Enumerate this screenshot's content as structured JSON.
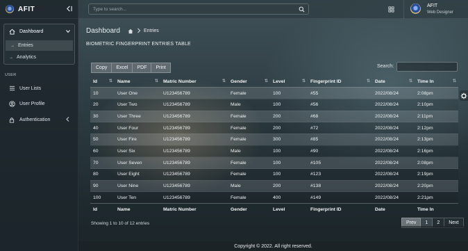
{
  "brand": {
    "name": "AFIT"
  },
  "sidebar": {
    "dashboard_label": "Dashboard",
    "sub_items": [
      {
        "label": "Entries"
      },
      {
        "label": "Analytics"
      }
    ],
    "section_label": "USER",
    "items": [
      {
        "label": "User Lists"
      },
      {
        "label": "User Profile"
      },
      {
        "label": "Authentication"
      }
    ]
  },
  "topbar": {
    "search_placeholder": "Type to search...",
    "user_name": "AFIT",
    "user_role": "Web Designer"
  },
  "breadcrumb": {
    "title": "Dashboard",
    "current": "Entries"
  },
  "table_title": "BIOMETRIC FINGERPRINT ENTRIES TABLE",
  "export_buttons": [
    "Copy",
    "Excel",
    "PDF",
    "Print"
  ],
  "table_search_label": "Search:",
  "table": {
    "columns": [
      "Id",
      "Name",
      "Matric Number",
      "Gender",
      "Level",
      "Fingerprint ID",
      "Date",
      "Time In"
    ],
    "rows": [
      [
        "10",
        "User One",
        "U123456789",
        "Female",
        "100",
        "#55",
        "2022/08/24",
        "2:08pm"
      ],
      [
        "20",
        "User Two",
        "U123456789",
        "Male",
        "100",
        "#56",
        "2022/08/24",
        "2:10pm"
      ],
      [
        "30",
        "User Three",
        "U123456789",
        "Female",
        "200",
        "#68",
        "2022/08/24",
        "2:11pm"
      ],
      [
        "40",
        "User Four",
        "U123456789",
        "Female",
        "200",
        "#72",
        "2022/08/24",
        "2:12pm"
      ],
      [
        "50",
        "User Fire",
        "U123456789",
        "Female",
        "300",
        "#85",
        "2022/08/24",
        "2:13pm"
      ],
      [
        "60",
        "User Six",
        "U123456789",
        "Male",
        "100",
        "#90",
        "2022/08/24",
        "2:16pm"
      ],
      [
        "70",
        "User Seven",
        "U123456789",
        "Female",
        "100",
        "#105",
        "2022/08/24",
        "2:08pm"
      ],
      [
        "80",
        "User Eight",
        "U123456789",
        "Female",
        "100",
        "#123",
        "2022/08/24",
        "2:19pm"
      ],
      [
        "90",
        "User Nine",
        "U123456789",
        "Male",
        "200",
        "#138",
        "2022/08/24",
        "2:20pm"
      ],
      [
        "100",
        "User Ten",
        "U123456789",
        "Female",
        "400",
        "#149",
        "2022/08/24",
        "2:21pm"
      ]
    ]
  },
  "table_info": "Showing 1 to 10 of 12 entries",
  "pagination": {
    "prev": "Prev",
    "pages": [
      "1",
      "2"
    ],
    "next": "Next",
    "active": "1"
  },
  "footer": "Copyright © 2022. All right reserved."
}
